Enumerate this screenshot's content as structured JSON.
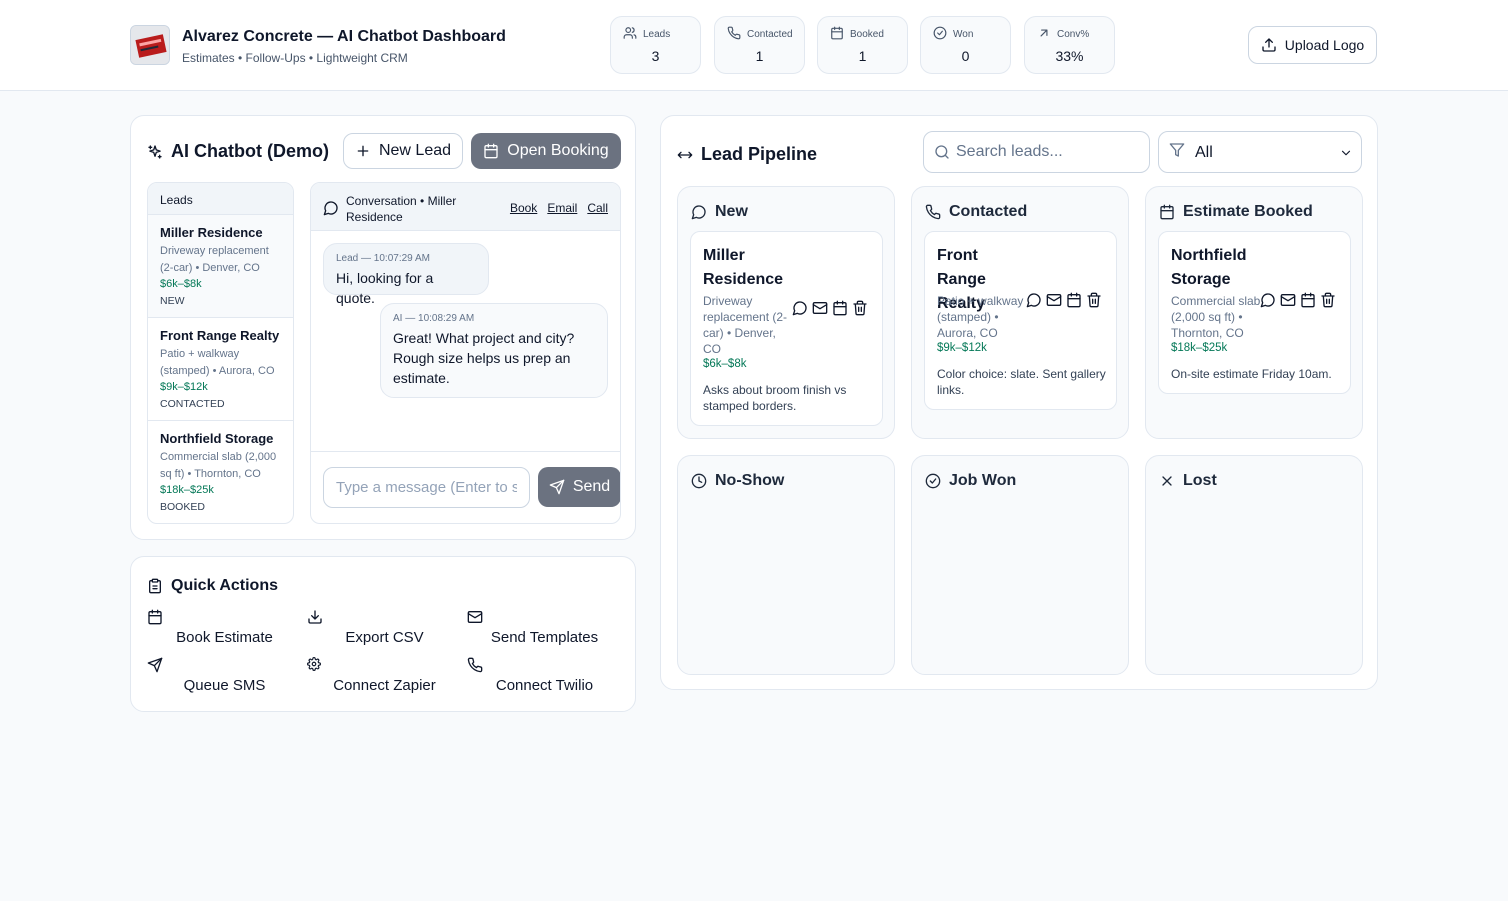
{
  "header": {
    "title": "Alvarez Concrete — AI Chatbot Dashboard",
    "subtitle": "Estimates • Follow-Ups • Lightweight CRM",
    "stats": [
      {
        "label": "Leads",
        "value": "3",
        "icon": "users-icon"
      },
      {
        "label": "Contacted",
        "value": "1",
        "icon": "phone-icon"
      },
      {
        "label": "Booked",
        "value": "1",
        "icon": "calendar-icon"
      },
      {
        "label": "Won",
        "value": "0",
        "icon": "check-circle-icon"
      },
      {
        "label": "Conv%",
        "value": "33%",
        "icon": "arrow-up-right-icon"
      }
    ],
    "upload_label": "Upload Logo"
  },
  "chatbot": {
    "title": "AI Chatbot (Demo)",
    "new_lead_label": "New Lead",
    "open_booking_label": "Open Booking",
    "leads_header": "Leads",
    "leads": [
      {
        "name": "Miller Residence",
        "desc": "Driveway replacement (2-car) • Denver, CO",
        "price": "$6k–$8k",
        "status": "NEW"
      },
      {
        "name": "Front Range Realty",
        "desc": "Patio + walkway (stamped) • Aurora, CO",
        "price": "$9k–$12k",
        "status": "CONTACTED"
      },
      {
        "name": "Northfield Storage",
        "desc": "Commercial slab (2,000 sq ft) • Thornton, CO",
        "price": "$18k–$25k",
        "status": "BOOKED"
      }
    ],
    "conversation": {
      "title": "Conversation • Miller Residence",
      "links": {
        "book": "Book",
        "email": "Email",
        "call": "Call"
      },
      "messages": [
        {
          "meta": "Lead — 10:07:29 AM",
          "text": "Hi, looking for a quote."
        },
        {
          "meta": "AI — 10:08:29 AM",
          "text": "Great! What project and city? Rough size helps us prep an estimate."
        }
      ],
      "input_placeholder": "Type a message (Enter to send)",
      "send_label": "Send"
    }
  },
  "quick_actions": {
    "title": "Quick Actions",
    "items": [
      {
        "label": "Book Estimate",
        "icon": "calendar-icon"
      },
      {
        "label": "Export CSV",
        "icon": "download-icon"
      },
      {
        "label": "Send Templates",
        "icon": "mail-icon"
      },
      {
        "label": "Queue SMS",
        "icon": "send-icon"
      },
      {
        "label": "Connect Zapier",
        "icon": "gear-icon"
      },
      {
        "label": "Connect Twilio",
        "icon": "phone-icon"
      }
    ]
  },
  "pipeline": {
    "title": "Lead Pipeline",
    "search_placeholder": "Search leads...",
    "filter_value": "All",
    "columns": [
      {
        "title": "New",
        "icon": "message-circle-icon",
        "cards": [
          {
            "name": "Miller Residence",
            "desc": "Driveway replacement (2-car) • Denver, CO",
            "price": "$6k–$8k",
            "note": "Asks about broom finish vs stamped borders."
          }
        ]
      },
      {
        "title": "Contacted",
        "icon": "phone-icon",
        "cards": [
          {
            "name": "Front Range Realty",
            "desc": "Patio + walkway (stamped) • Aurora, CO",
            "price": "$9k–$12k",
            "note": "Color choice: slate. Sent gallery links."
          }
        ]
      },
      {
        "title": "Estimate Booked",
        "icon": "calendar-icon",
        "cards": [
          {
            "name": "Northfield Storage",
            "desc": "Commercial slab (2,000 sq ft) • Thornton, CO",
            "price": "$18k–$25k",
            "note": "On-site estimate Friday 10am."
          }
        ]
      },
      {
        "title": "No-Show",
        "icon": "clock-icon",
        "cards": []
      },
      {
        "title": "Job Won",
        "icon": "check-circle-icon",
        "cards": []
      },
      {
        "title": "Lost",
        "icon": "x-icon",
        "cards": []
      }
    ]
  },
  "colors": {
    "accent_gray": "#6b7280",
    "price_green": "#047857",
    "border": "#e2e8f0"
  }
}
